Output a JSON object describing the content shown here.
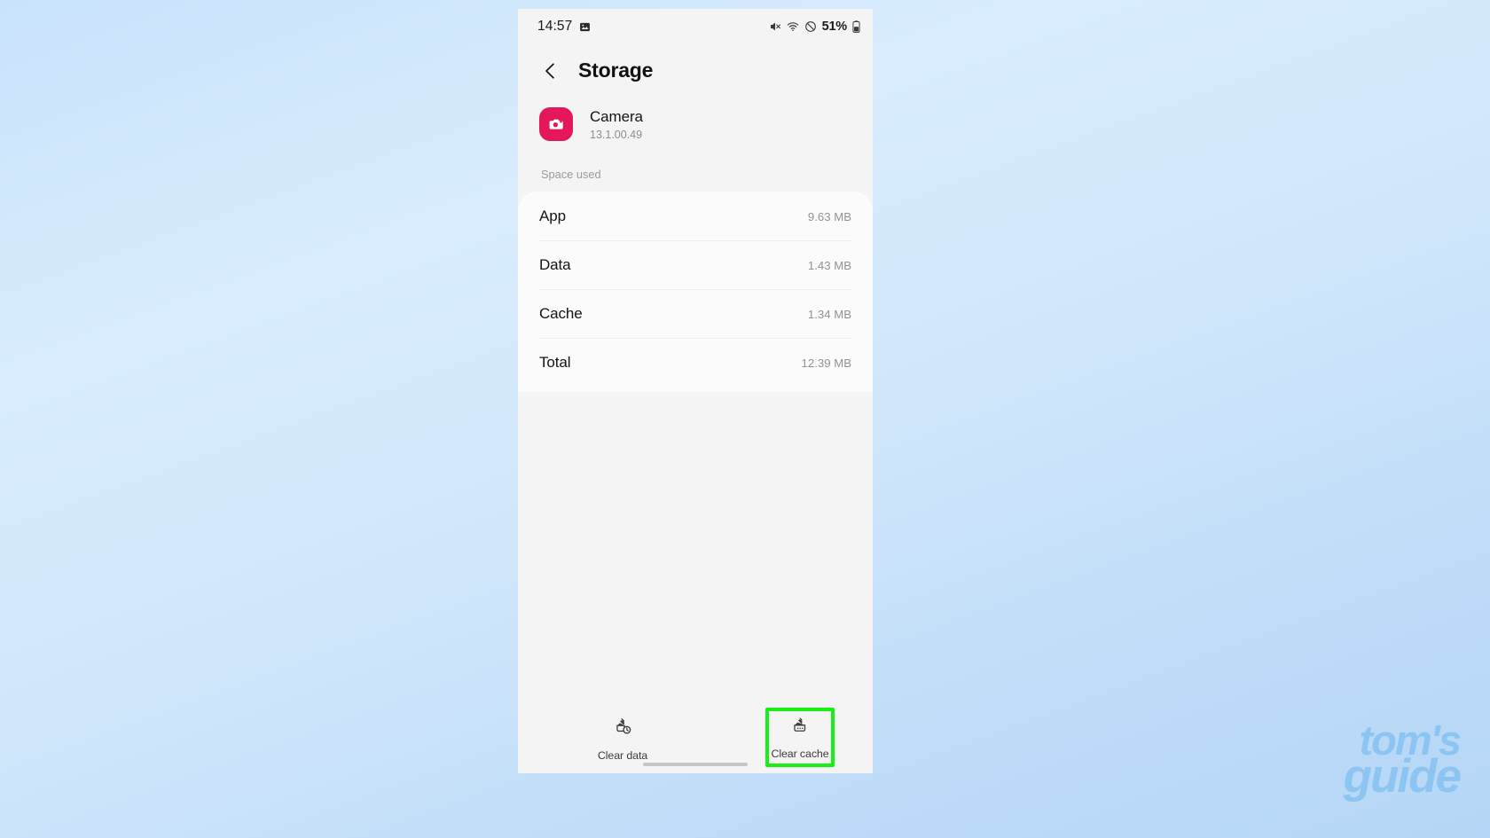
{
  "statusbar": {
    "time": "14:57",
    "battery_percent": "51%",
    "icons": {
      "photo": "photo-icon",
      "mute": "mute-icon",
      "wifi": "wifi-icon",
      "dnd": "do-not-disturb-icon",
      "battery": "battery-icon"
    }
  },
  "header": {
    "back_icon": "back-chevron-icon",
    "title": "Storage"
  },
  "app": {
    "icon_name": "camera-app-icon",
    "icon_color": "#e5175b",
    "name": "Camera",
    "version": "13.1.00.49"
  },
  "section": {
    "label": "Space used"
  },
  "rows": [
    {
      "label": "App",
      "value": "9.63 MB"
    },
    {
      "label": "Data",
      "value": "1.43 MB"
    },
    {
      "label": "Cache",
      "value": "1.34 MB"
    },
    {
      "label": "Total",
      "value": "12.39 MB"
    }
  ],
  "actions": [
    {
      "label": "Clear data",
      "icon": "broom-clock-icon",
      "highlighted": false
    },
    {
      "label": "Clear cache",
      "icon": "broom-sparkle-icon",
      "highlighted": true
    }
  ],
  "highlight": {
    "color": "#16f016"
  },
  "watermark": {
    "line1": "tom's",
    "line2": "guide",
    "color": "#8cc4f2"
  }
}
